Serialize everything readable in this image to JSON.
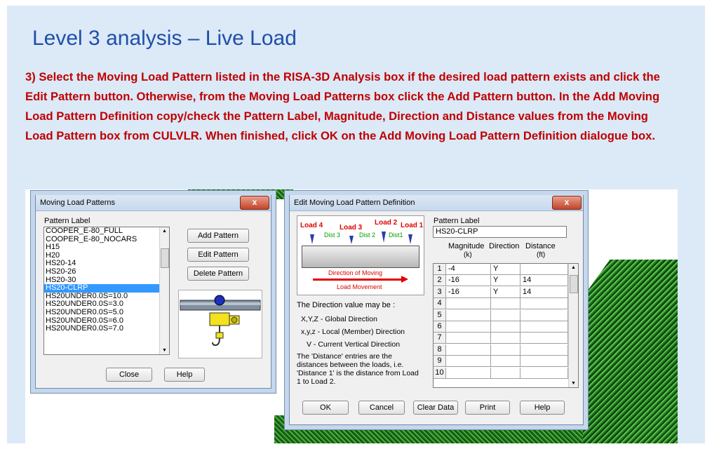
{
  "slide": {
    "title": "Level 3 analysis – Live Load",
    "instructions": "3) Select the Moving Load Pattern listed in the RISA-3D Analysis box if the desired load pattern exists and click the Edit Pattern button. Otherwise, from the Moving Load Patterns box click the Add Pattern button. In the Add Moving Load Pattern Definition copy/check the Pattern Label, Magnitude, Direction and Distance values from the Moving Load Pattern box from CULVLR. When finished, click OK on the Add Moving Load Pattern Definition dialogue box."
  },
  "moving_load_patterns": {
    "title": "Moving Load Patterns",
    "close_icon": "x",
    "list_label": "Pattern Label",
    "items": [
      "COOPER_E-80_FULL",
      "COOPER_E-80_NOCARS",
      "H15",
      "H20",
      "HS20-14",
      "HS20-26",
      "HS20-30",
      "HS20-CLRP",
      "HS20UNDER0.0S=10.0",
      "HS20UNDER0.0S=3.0",
      "HS20UNDER0.0S=5.0",
      "HS20UNDER0.0S=6.0",
      "HS20UNDER0.0S=7.0"
    ],
    "selected_index": 7,
    "add_button": "Add Pattern",
    "edit_button": "Edit Pattern",
    "delete_button": "Delete Pattern",
    "close_button": "Close",
    "help_button": "Help"
  },
  "edit_pattern": {
    "title": "Edit Moving Load Pattern Definition",
    "close_icon": "x",
    "diagram": {
      "loads": [
        "Load 4",
        "Load 3",
        "Load 2",
        "Load 1"
      ],
      "dists": [
        "Dist 3",
        "Dist 2",
        "Dist1"
      ],
      "direction_label": "Direction of Moving",
      "movement_label": "Load Movement"
    },
    "pattern_label_caption": "Pattern Label",
    "pattern_label_value": "HS20-CLRP",
    "col_magnitude": "Magnitude",
    "col_magnitude_unit": "(k)",
    "col_direction": "Direction",
    "col_distance": "Distance",
    "col_distance_unit": "(ft)",
    "rows": [
      {
        "n": "1",
        "mag": "-4",
        "dir": "Y",
        "dist": ""
      },
      {
        "n": "2",
        "mag": "-16",
        "dir": "Y",
        "dist": "14"
      },
      {
        "n": "3",
        "mag": "-16",
        "dir": "Y",
        "dist": "14"
      },
      {
        "n": "4",
        "mag": "",
        "dir": "",
        "dist": ""
      },
      {
        "n": "5",
        "mag": "",
        "dir": "",
        "dist": ""
      },
      {
        "n": "6",
        "mag": "",
        "dir": "",
        "dist": ""
      },
      {
        "n": "7",
        "mag": "",
        "dir": "",
        "dist": ""
      },
      {
        "n": "8",
        "mag": "",
        "dir": "",
        "dist": ""
      },
      {
        "n": "9",
        "mag": "",
        "dir": "",
        "dist": ""
      },
      {
        "n": "10",
        "mag": "",
        "dir": "",
        "dist": ""
      }
    ],
    "help_direction_title": "The Direction value may be :",
    "help_global": "X,Y,Z -  Global Direction",
    "help_local": "x,y,z  -  Local (Member) Direction",
    "help_vertical": "V   -  Current Vertical Direction",
    "help_distance": "The 'Distance' entries are the distances between the loads, i.e. 'Distance 1' is the distance from Load 1 to Load 2.",
    "ok_button": "OK",
    "cancel_button": "Cancel",
    "clear_button": "Clear Data",
    "print_button": "Print",
    "help_button": "Help"
  },
  "colors": {
    "title": "#1f4fa8",
    "instructions": "#c00000",
    "load_red": "#e00000",
    "dist_green": "#00a000",
    "arrow_blue": "#2a3db0"
  }
}
